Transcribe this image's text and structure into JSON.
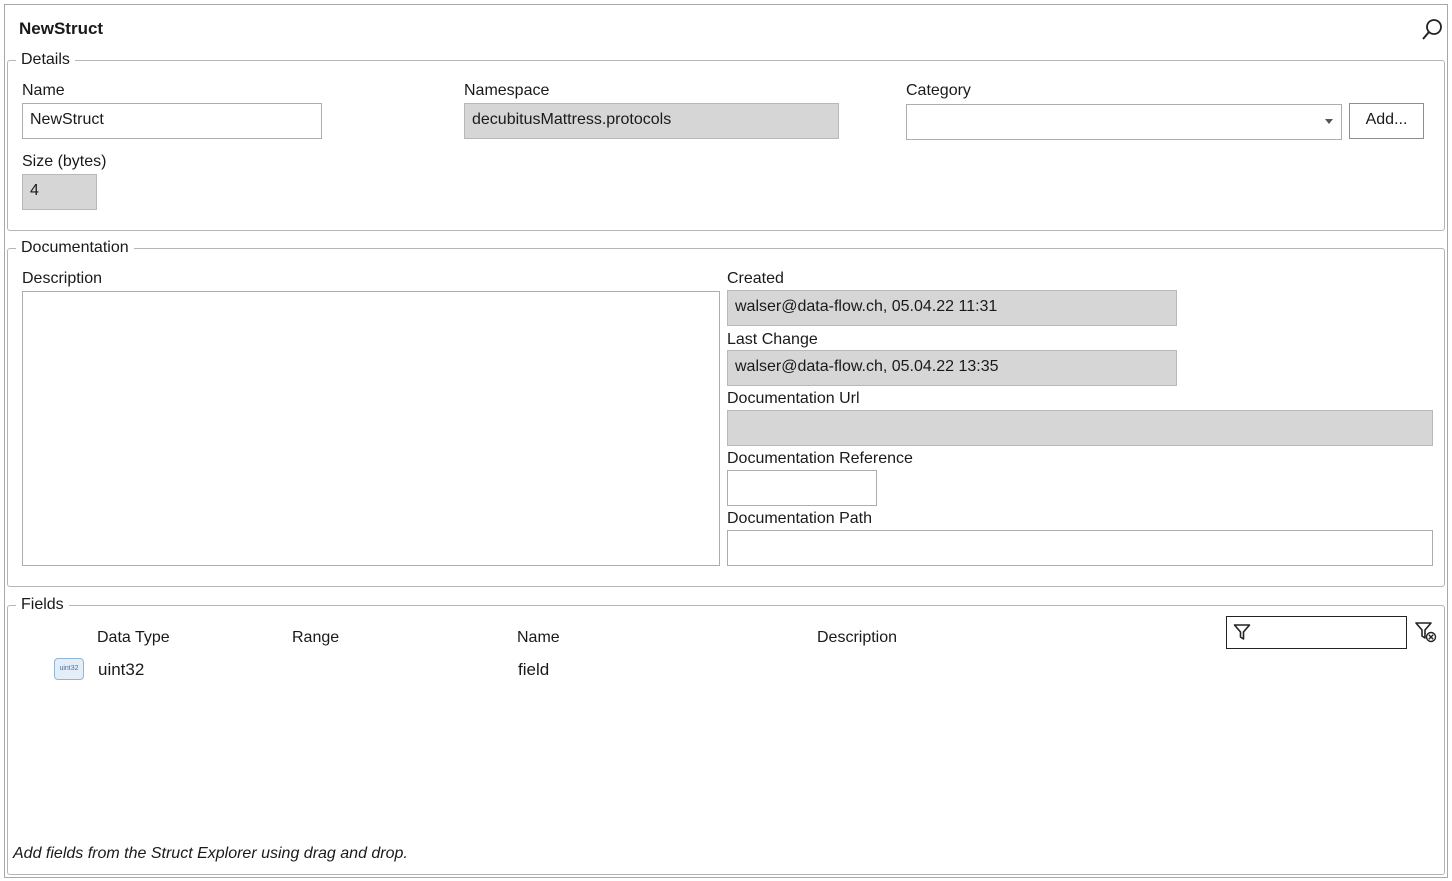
{
  "header": {
    "title": "NewStruct"
  },
  "details": {
    "legend": "Details",
    "name_label": "Name",
    "name_value": "NewStruct",
    "namespace_label": "Namespace",
    "namespace_value": "decubitusMattress.protocols",
    "category_label": "Category",
    "category_value": "",
    "add_label": "Add...",
    "size_label": "Size (bytes)",
    "size_value": "4"
  },
  "documentation": {
    "legend": "Documentation",
    "description_label": "Description",
    "description_value": "",
    "created_label": "Created",
    "created_value": "walser@data-flow.ch, 05.04.22 11:31",
    "last_change_label": "Last Change",
    "last_change_value": "walser@data-flow.ch, 05.04.22 13:35",
    "url_label": "Documentation Url",
    "url_value": "",
    "reference_label": "Documentation Reference",
    "reference_value": "",
    "path_label": "Documentation Path",
    "path_value": ""
  },
  "fields": {
    "legend": "Fields",
    "columns": [
      "Data Type",
      "Range",
      "Name",
      "Description"
    ],
    "rows": [
      {
        "icon_text": "uint32",
        "data_type": "uint32",
        "range": "",
        "name": "field",
        "description": ""
      }
    ],
    "filter_value": "",
    "hint": "Add fields from the Struct Explorer using drag and drop."
  },
  "icons": {
    "search": "search-icon",
    "filter": "filter-icon",
    "clear_filter": "clear-filter-icon",
    "type": "uint32-type-icon"
  }
}
